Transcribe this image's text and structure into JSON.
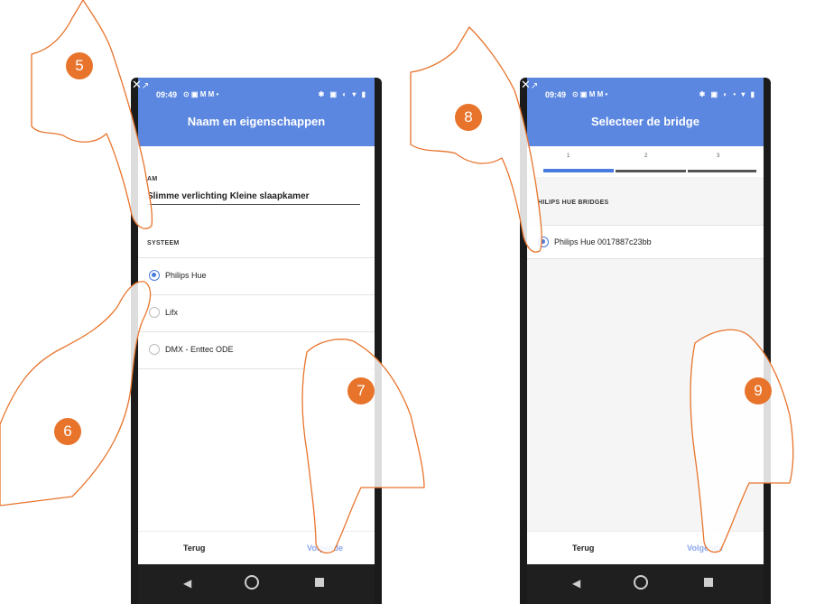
{
  "left_phone": {
    "status_time": "09:49",
    "status_icons": "⊙ ▣ M M •",
    "status_right_icons": "✱ ▣ ◐ ▾ ▮",
    "title": "Naam en eigenschappen",
    "name_label": "AM",
    "name_value": "Slimme verlichting Kleine slaapkamer",
    "system_label": "SYSTEEM",
    "options": [
      {
        "label": "Philips Hue",
        "selected": true
      },
      {
        "label": "Lifx",
        "selected": false
      },
      {
        "label": "DMX - Enttec ODE",
        "selected": false
      }
    ],
    "back_label": "Terug",
    "next_label": "Volgende"
  },
  "right_phone": {
    "status_time": "09:49",
    "status_icons": "⊙ ▣ M M •",
    "status_right_icons": "✱ ▣ ◐ • ▾ ▮",
    "title": "Selecteer de bridge",
    "steps": [
      "1",
      "2",
      "3"
    ],
    "section_label": "HILIPS HUE BRIDGES",
    "bridge_label": "Philips Hue 0017887c23bb",
    "back_label": "Terug",
    "next_label": "Volgende"
  },
  "badges": {
    "b5": "5",
    "b6": "6",
    "b7": "7",
    "b8": "8",
    "b9": "9"
  },
  "colors": {
    "header_blue": "#5b87e0",
    "badge_orange": "#e8742c",
    "radio_blue": "#4a7be0",
    "hand_outline": "#e8742c"
  }
}
